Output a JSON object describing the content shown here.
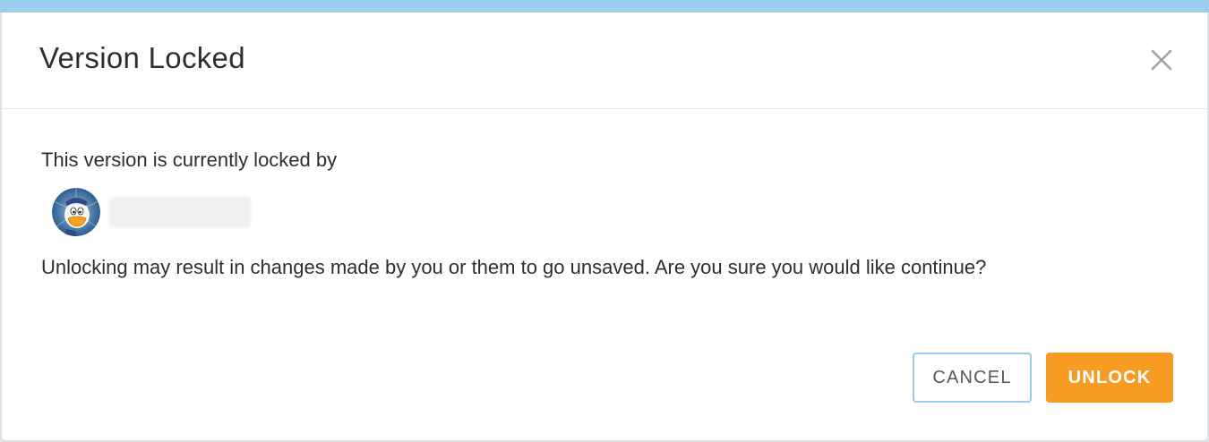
{
  "dialog": {
    "title": "Version Locked",
    "close_icon": "close-icon",
    "intro": "This version is currently locked by",
    "locked_by": {
      "avatar_icon": "user-avatar",
      "name": ""
    },
    "warning": "Unlocking may result in changes made by you or them to go unsaved. Are you sure you would like continue?",
    "buttons": {
      "cancel_label": "CANCEL",
      "unlock_label": "UNLOCK"
    }
  },
  "colors": {
    "accent_top_strip": "#9dcdee",
    "primary_button": "#f89b22",
    "secondary_button_border": "#9bcbec",
    "text": "#2b2f33"
  }
}
